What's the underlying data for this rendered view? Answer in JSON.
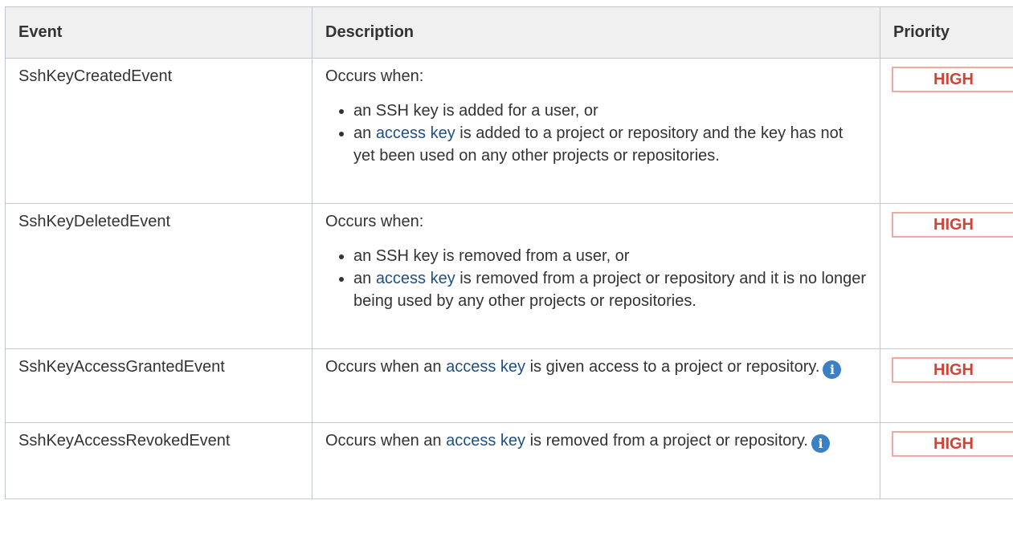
{
  "headers": {
    "event": "Event",
    "description": "Description",
    "priority": "Priority"
  },
  "rows": [
    {
      "event": "SshKeyCreatedEvent",
      "intro": "Occurs when:",
      "bullets": [
        {
          "text": "an SSH key is added for a user, or"
        },
        {
          "before": "an ",
          "link": "access key",
          "after": " is added to a project or repository and the key has not yet been used on any other projects or repositories."
        }
      ],
      "priority": "HIGH"
    },
    {
      "event": "SshKeyDeletedEvent",
      "intro": "Occurs when:",
      "bullets": [
        {
          "text": "an SSH key is removed from a user, or"
        },
        {
          "before": "an ",
          "link": "access key",
          "after": " is removed from a project or repository and it is no longer being used by any other projects or repositories."
        }
      ],
      "priority": "HIGH"
    },
    {
      "event": "SshKeyAccessGrantedEvent",
      "before": "Occurs when an ",
      "link": "access key",
      "after": " is given access to a project or repository.",
      "icon": "info-icon",
      "priority": "HIGH"
    },
    {
      "event": "SshKeyAccessRevokedEvent",
      "before": "Occurs when an ",
      "link": "access key",
      "after": " is removed from a project or repository.",
      "icon": "info-icon",
      "priority": "HIGH"
    }
  ],
  "colors": {
    "link": "#205081",
    "priority_high_text": "#d04437",
    "priority_high_border": "#f3a99f",
    "info_icon": "#3b7fc4",
    "header_bg": "#f0f0f0",
    "border": "#c1c7d0"
  }
}
